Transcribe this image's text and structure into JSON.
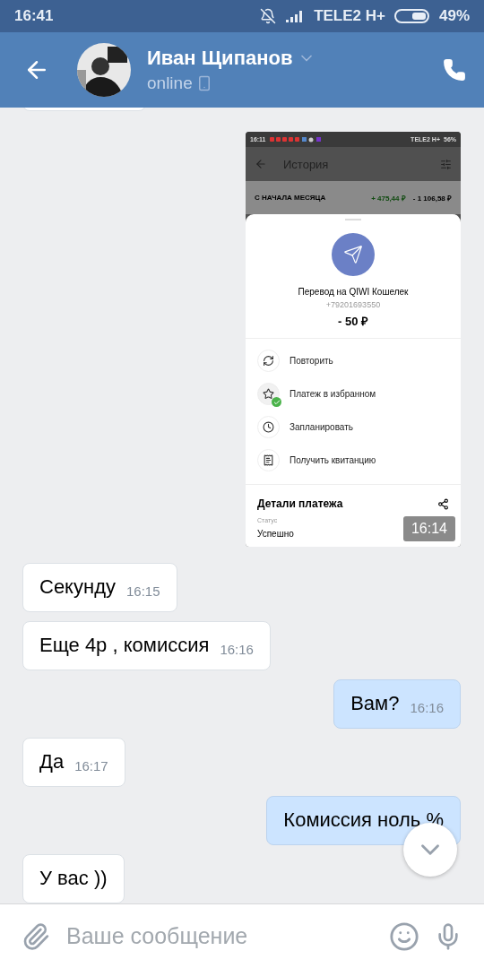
{
  "status_bar": {
    "time": "16:41",
    "carrier": "TELE2 H+",
    "battery": "49%"
  },
  "header": {
    "name": "Иван Щипанов",
    "status": "online"
  },
  "screenshot": {
    "status_bar": {
      "time": "16:11",
      "carrier": "TELE2 H+",
      "battery": "56%"
    },
    "title": "История",
    "summary": {
      "label": "С НАЧАЛА МЕСЯЦА",
      "income": "+ 475,44 ₽",
      "expense": "- 1 106,58 ₽"
    },
    "payment": {
      "title": "Перевод на QIWI Кошелек",
      "phone": "+79201693550",
      "amount": "- 50 ₽"
    },
    "actions": [
      {
        "label": "Повторить",
        "done": false
      },
      {
        "label": "Платеж в избранном",
        "done": true
      },
      {
        "label": "Запланировать",
        "done": false
      },
      {
        "label": "Получить квитанцию",
        "done": false
      }
    ],
    "details": {
      "title": "Детали платежа",
      "status_label": "Статус",
      "status_value": "Успешно"
    },
    "time": "16:14"
  },
  "messages": [
    {
      "text": "Секунду",
      "time": "16:15",
      "outgoing": false
    },
    {
      "text": "Еще 4р , комиссия",
      "time": "16:16",
      "outgoing": false
    },
    {
      "text": "Вам?",
      "time": "16:16",
      "outgoing": true
    },
    {
      "text": "Да",
      "time": "16:17",
      "outgoing": false
    },
    {
      "text": "Комиссия ноль %",
      "outgoing": true
    },
    {
      "text": "У вас ))",
      "outgoing": false
    }
  ],
  "composer": {
    "placeholder": "Ваше сообщение"
  }
}
